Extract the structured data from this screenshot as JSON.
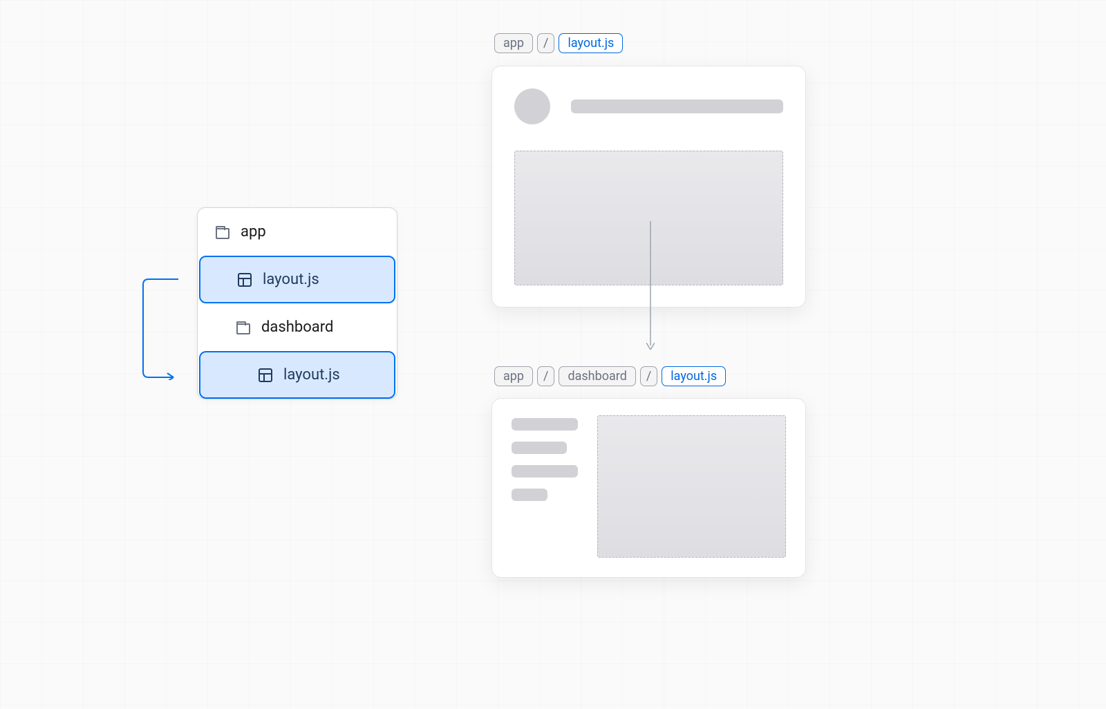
{
  "tree": {
    "items": [
      {
        "label": "app",
        "type": "folder",
        "level": 1,
        "selected": false
      },
      {
        "label": "layout.js",
        "type": "layout",
        "level": 2,
        "selected": true
      },
      {
        "label": "dashboard",
        "type": "folder",
        "level": 2,
        "selected": false
      },
      {
        "label": "layout.js",
        "type": "layout",
        "level": 3,
        "selected": true
      }
    ]
  },
  "breadcrumb_top": {
    "segments": [
      {
        "text": "app",
        "style": "gray"
      },
      {
        "text": "/",
        "style": "gray",
        "slash": true
      },
      {
        "text": "layout.js",
        "style": "blue"
      }
    ]
  },
  "breadcrumb_bottom": {
    "segments": [
      {
        "text": "app",
        "style": "gray"
      },
      {
        "text": "/",
        "style": "gray",
        "slash": true
      },
      {
        "text": "dashboard",
        "style": "gray"
      },
      {
        "text": "/",
        "style": "gray",
        "slash": true
      },
      {
        "text": "layout.js",
        "style": "blue"
      }
    ]
  }
}
